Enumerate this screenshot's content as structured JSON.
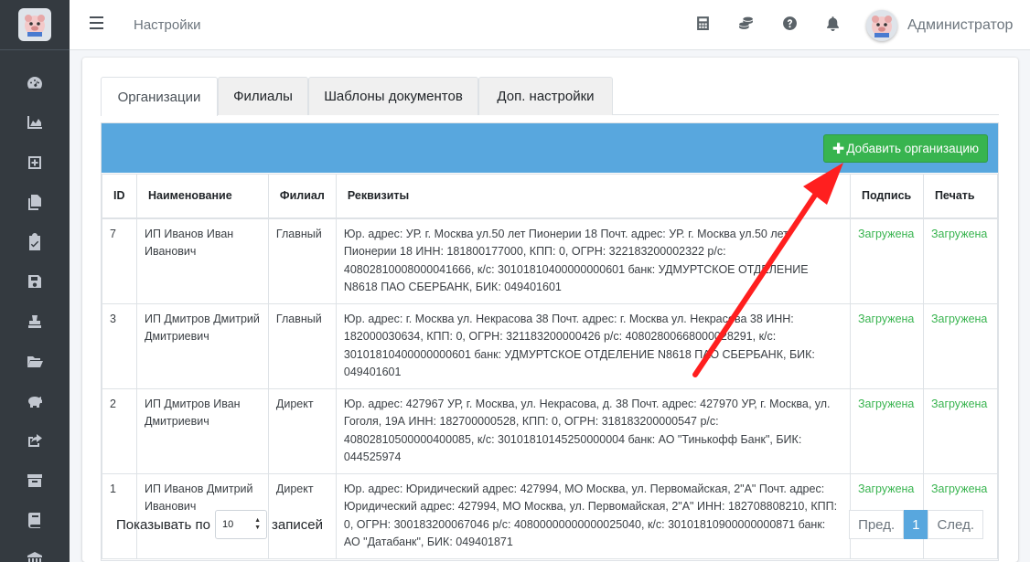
{
  "navbar": {
    "title": "Настройки",
    "user_name": "Администратор",
    "icons": [
      "calculator-icon",
      "coins-icon",
      "question-circle-icon",
      "bell-icon"
    ]
  },
  "sidebar": {
    "icons": [
      "tachometer-icon",
      "chart-area-icon",
      "plus-square-icon",
      "copy-icon",
      "clipboard-check-icon",
      "save-icon",
      "stamp-icon",
      "folder-open-icon",
      "piggy-bank-icon",
      "share-square-icon",
      "archive-icon",
      "book-icon",
      "university-icon"
    ]
  },
  "tabs": [
    {
      "label": "Организации",
      "active": true
    },
    {
      "label": "Филиалы",
      "active": false
    },
    {
      "label": "Шаблоны документов",
      "active": false
    },
    {
      "label": "Доп. настройки",
      "active": false
    }
  ],
  "add_button": "Добавить организацию",
  "table": {
    "headers": [
      "ID",
      "Наименование",
      "Филиал",
      "Реквизиты",
      "Подпись",
      "Печать"
    ],
    "rows": [
      {
        "id": "7",
        "name": "ИП Иванов Иван Иванович",
        "branch": "Главный",
        "details": "Юр. адрес: УР. г. Москва ул.50 лет Пионерии 18 Почт. адрес: УР. г. Москва ул.50 лет Пионерии 18 ИНН: 181800177000, КПП: 0, ОГРН: 322183200002322 р/с: 40802810008000041666, к/с: 30101810400000000601 банк: УДМУРТСКОЕ ОТДЕЛЕНИЕ N8618 ПАО СБЕРБАНК, БИК: 049401601",
        "signature": "Загружена",
        "stamp": "Загружена"
      },
      {
        "id": "3",
        "name": "ИП Дмитров Дмитрий Дмитриевич",
        "branch": "Главный",
        "details": "Юр. адрес: г. Москва ул. Некрасова 38 Почт. адрес: г. Москва ул. Некрасова 38 ИНН: 182000030634, КПП: 0, ОГРН: 321183200000426 р/с: 40802800668000028291, к/с: 30101810400000000601 банк: УДМУРТСКОЕ ОТДЕЛЕНИЕ N8618 ПАО СБЕРБАНК, БИК: 049401601",
        "signature": "Загружена",
        "stamp": "Загружена"
      },
      {
        "id": "2",
        "name": "ИП Дмитров Иван Дмитриевич",
        "branch": "Директ",
        "details": "Юр. адрес: 427967 УР, г. Москва, ул. Некрасова, д. 38 Почт. адрес: 427970 УР, г. Москва, ул. Гоголя, 19А ИНН: 182700000528, КПП: 0, ОГРН: 318183200000547 р/с: 40802810500000400085, к/с: 30101810145250000004 банк: АО \"Тинькофф Банк\", БИК: 044525974",
        "signature": "Загружена",
        "stamp": "Загружена"
      },
      {
        "id": "1",
        "name": "ИП Иванов Дмитрий Иванович",
        "branch": "Директ",
        "details": "Юр. адрес: Юридический адрес: 427994, МО Москва, ул. Первомайская, 2\"А\" Почт. адрес: Юридический адрес: 427994, МО Москва, ул. Первомайская, 2\"А\" ИНН: 182708808210, КПП: 0, ОГРН: 300183200067046 р/с: 40800000000000025040, к/с: 30101810900000000871 банк: АО \"Датабанк\", БИК: 049401871",
        "signature": "Загружена",
        "stamp": "Загружена"
      }
    ]
  },
  "footer": {
    "show_label": "Показывать по",
    "per_page": "10",
    "records_label": "записей",
    "prev": "Пред.",
    "current_page": "1",
    "next": "След."
  },
  "annotation": {
    "arrow_color": "#ff1f1f"
  }
}
